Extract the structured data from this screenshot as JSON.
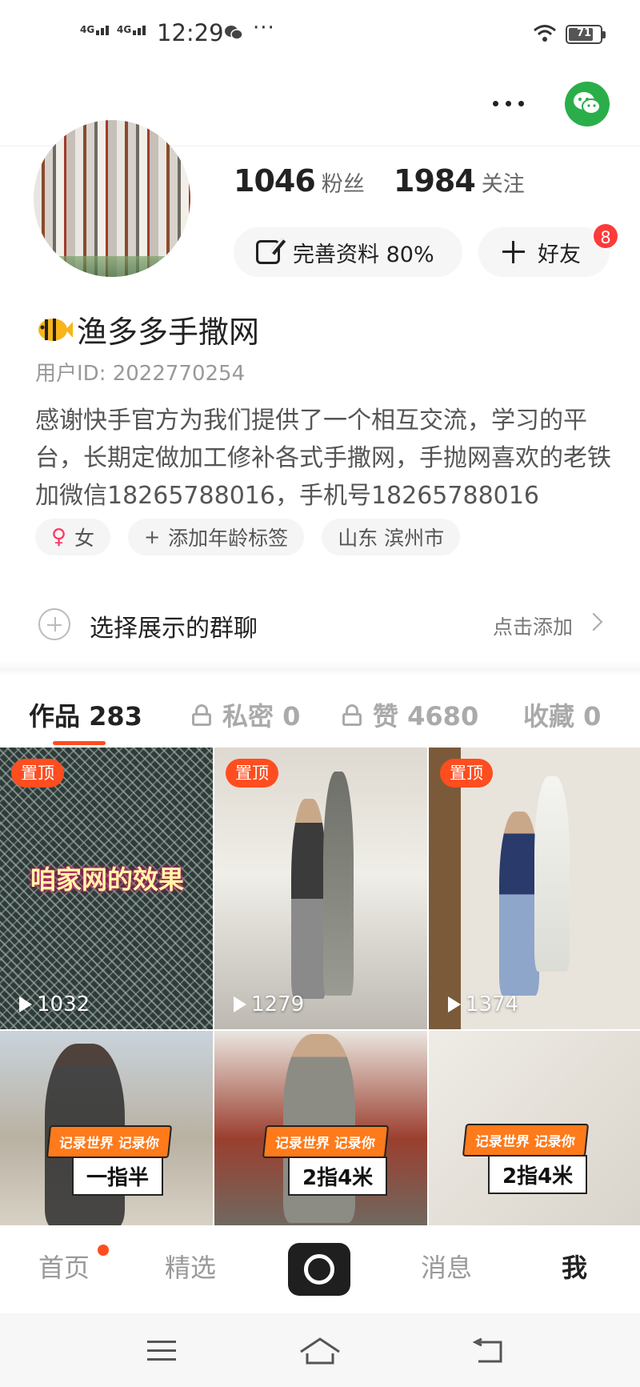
{
  "status_bar": {
    "sim1": "4G",
    "sim2": "4G",
    "time": "12:29",
    "dots": "···",
    "battery": "71"
  },
  "profile": {
    "fans_count": "1046",
    "fans_label": "粉丝",
    "following_count": "1984",
    "following_label": "关注",
    "edit_profile_label": "完善资料 80%",
    "add_friend_label": "好友",
    "friend_badge": "8",
    "username": "渔多多手撒网",
    "user_id": "用户ID: 2022770254",
    "bio": "感谢快手官方为我们提供了一个相互交流，学习的平台，长期定做加工修补各式手撒网，手抛网喜欢的老铁加微信18265788016，手机号18265788016"
  },
  "tags": {
    "gender": "女",
    "add_age": "添加年龄标签",
    "location": "山东 滨州市"
  },
  "group_chat": {
    "label": "选择展示的群聊",
    "action": "点击添加"
  },
  "tabs": [
    {
      "label": "作品 283"
    },
    {
      "label": "私密 0"
    },
    {
      "label": "赞 4680"
    },
    {
      "label": "收藏 0"
    }
  ],
  "videos": [
    {
      "pin": "置顶",
      "plays": "1032",
      "overlay": "咱家网的效果"
    },
    {
      "pin": "置顶",
      "plays": "1279"
    },
    {
      "pin": "置顶",
      "plays": "1374"
    },
    {
      "sticker_top": "记录世界 记录你",
      "sticker_bottom": "一指半"
    },
    {
      "sticker_top": "记录世界 记录你",
      "sticker_bottom": "2指4米"
    },
    {
      "sticker_top": "记录世界 记录你",
      "sticker_bottom": "2指4米"
    }
  ],
  "bottom_nav": {
    "home": "首页",
    "featured": "精选",
    "messages": "消息",
    "me": "我"
  },
  "colors": {
    "accent": "#fe4d1f",
    "wechat_green": "#2aae4a",
    "badge_red": "#fe3a3a"
  }
}
